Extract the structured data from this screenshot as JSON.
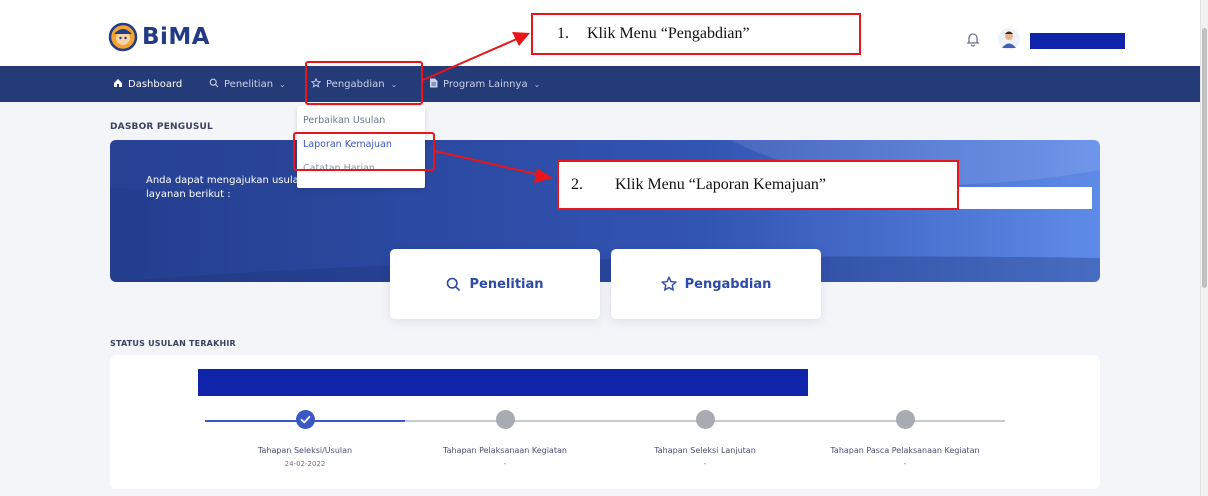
{
  "app": {
    "logo_text": "BiMA"
  },
  "nav": {
    "items": [
      {
        "label": "Dashboard",
        "icon": "home-icon"
      },
      {
        "label": "Penelitian",
        "icon": "search-icon"
      },
      {
        "label": "Pengabdian",
        "icon": "star-icon"
      },
      {
        "label": "Program Lainnya",
        "icon": "document-icon"
      }
    ],
    "pengabdian_dropdown": [
      "Perbaikan Usulan",
      "Laporan Kemajuan",
      "Catatan Harian"
    ]
  },
  "dashboard": {
    "title": "DASBOR PENGUSUL",
    "banner_text": "Anda dapat mengajukan usulan terkait dengan layanan berikut :",
    "cards": [
      {
        "label": "Penelitian",
        "icon": "search-icon"
      },
      {
        "label": "Pengabdian",
        "icon": "star-icon"
      }
    ]
  },
  "status": {
    "title": "STATUS USULAN TERAKHIR",
    "steps": [
      {
        "label": "Tahapan Seleksi/Usulan",
        "date": "24-02-2022",
        "done": true
      },
      {
        "label": "Tahapan Pelaksanaan Kegiatan",
        "date": "-",
        "done": false
      },
      {
        "label": "Tahapan Seleksi Lanjutan",
        "date": "-",
        "done": false
      },
      {
        "label": "Tahapan Pasca Pelaksanaan Kegiatan",
        "date": "-",
        "done": false
      }
    ]
  },
  "annotations": {
    "step1": {
      "number": "1.",
      "text": "Klik Menu “Pengabdian”"
    },
    "step2": {
      "number": "2.",
      "text": "Klik Menu “Laporan Kemajuan”"
    }
  },
  "colors": {
    "nav_bg": "#243b78",
    "accent": "#3a57c4",
    "annotation": "#e8161b",
    "redaction": "#0f24a8"
  }
}
